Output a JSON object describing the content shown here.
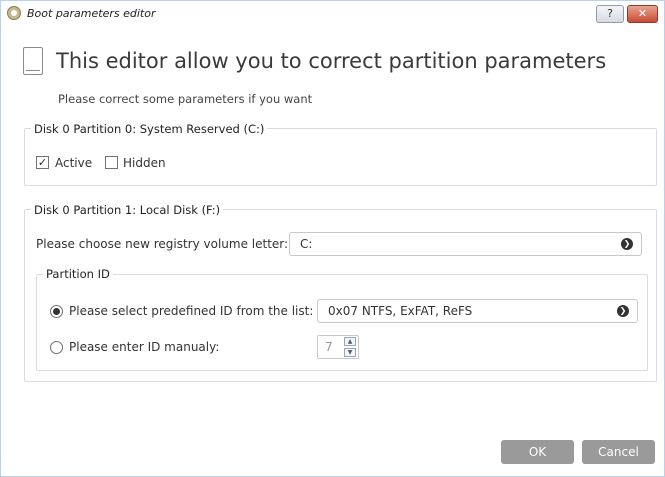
{
  "window": {
    "title": "Boot parameters editor",
    "help_label": "?",
    "close_label": "✕"
  },
  "header": {
    "title": "This editor allow you to correct partition parameters",
    "subtitle": "Please correct some parameters if you want"
  },
  "partition0": {
    "legend": "Disk 0 Partition 0: System Reserved (C:)",
    "active_label": "Active",
    "active_checked": true,
    "active_mark": "✓",
    "hidden_label": "Hidden",
    "hidden_checked": false
  },
  "partition1": {
    "legend": "Disk 0 Partition 1: Local Disk (F:)",
    "registry_label": "Please choose new registry volume letter:",
    "registry_value": "C:",
    "partition_id": {
      "legend": "Partition ID",
      "predefined_label": "Please select predefined ID from the list:",
      "predefined_value": "0x07 NTFS, ExFAT, ReFS",
      "predefined_selected": true,
      "manual_label": "Please enter ID manualy:",
      "manual_value": "7"
    }
  },
  "footer": {
    "ok_label": "OK",
    "cancel_label": "Cancel"
  },
  "icons": {
    "arrow_glyph": "❯",
    "spin_up_glyph": "▲",
    "spin_down_glyph": "▼"
  }
}
